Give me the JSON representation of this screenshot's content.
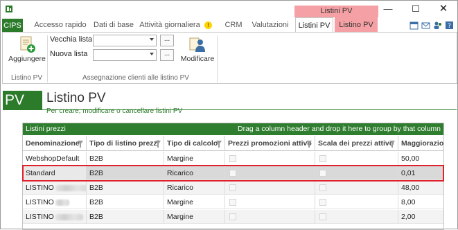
{
  "ribbon_context": {
    "title": "Listini PV"
  },
  "tabs": [
    {
      "label": "CIPS"
    },
    {
      "label": "Accesso rapido"
    },
    {
      "label": "Dati di base"
    },
    {
      "label": "Attività giornaliera"
    },
    {
      "label": "CRM"
    },
    {
      "label": "Valutazioni"
    },
    {
      "label": "Listini PV"
    },
    {
      "label": "Listino PV"
    }
  ],
  "ribbon": {
    "add_label": "Aggiungere",
    "group_listino": "Listino PV",
    "old_list_label": "Vecchia lista",
    "new_list_label": "Nuova lista",
    "ellipsis": "...",
    "modify_label": "Modificare",
    "group_assign": "Assegnazione clienti alle listino PV"
  },
  "page": {
    "badge": "PV",
    "title": "Listino PV",
    "subtitle": "Per creare, modificare o cancellare listini PV"
  },
  "grid": {
    "title": "Listini prezzi",
    "group_hint": "Drag a column header and drop it here to group by that column",
    "columns": [
      "Denominazione",
      "Tipo di listino prezzi",
      "Tipo di calcolo",
      "Prezzi promozioni attivo",
      "Scala dei prezzi attivo",
      "Maggiorazio"
    ],
    "rows": [
      {
        "name": "WebshopDefault",
        "type": "B2B",
        "calc": "Margine",
        "value": "50,00"
      },
      {
        "name": "Standard",
        "type": "B2B",
        "calc": "Ricarico",
        "value": "0,01"
      },
      {
        "name": "LISTINO",
        "type": "B2B",
        "calc": "Ricarico",
        "value": "48,00"
      },
      {
        "name": "LISTINO",
        "type": "B2B",
        "calc": "Margine",
        "value": "8,00"
      },
      {
        "name": "LISTINO",
        "type": "B2B",
        "calc": "Margine",
        "value": "2,00"
      }
    ]
  },
  "colors": {
    "accent_green": "#2b7b2b",
    "context_pink": "#f4a0a4",
    "selection_border": "#e0202a"
  },
  "icons": [
    "app-icon",
    "minimize-icon",
    "maximize-icon",
    "close-icon",
    "warning-icon",
    "add-document-icon",
    "modify-users-icon",
    "filter-icon"
  ]
}
